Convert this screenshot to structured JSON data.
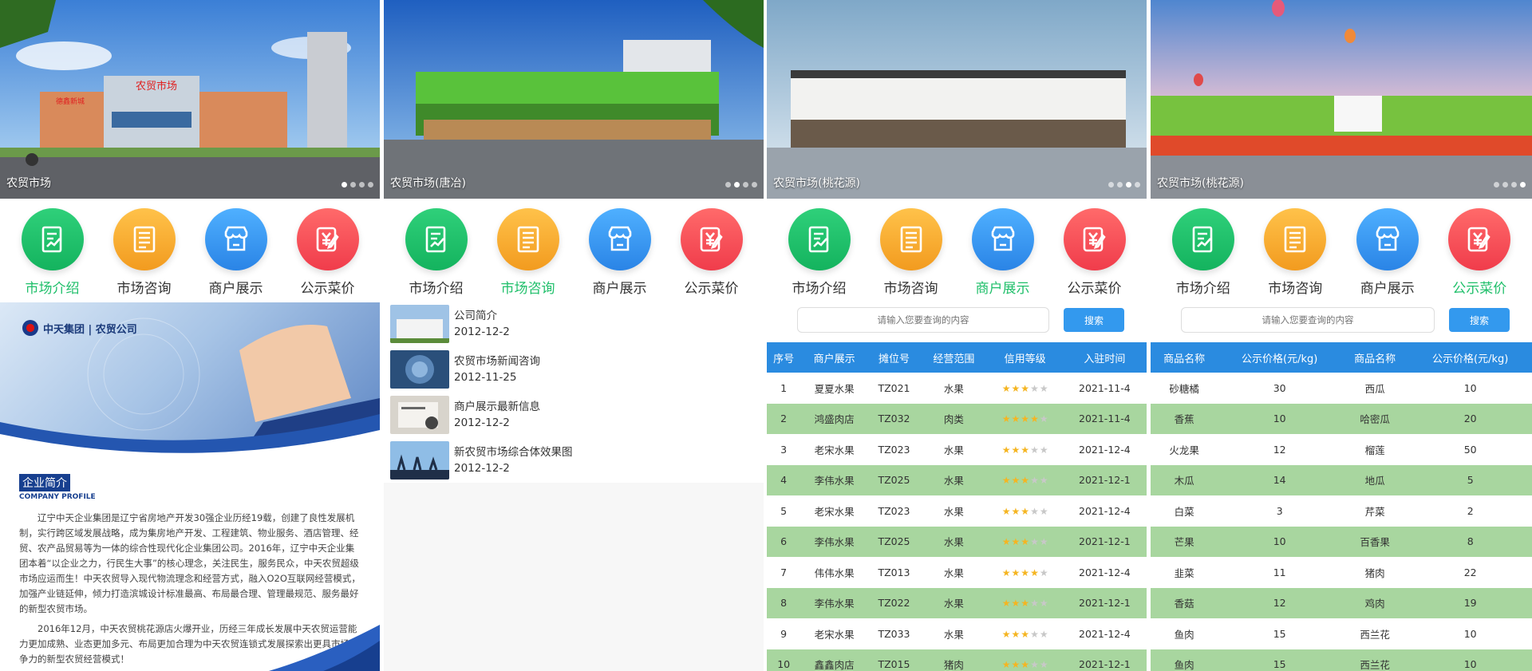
{
  "nav_items": [
    "市场介绍",
    "市场咨询",
    "商户展示",
    "公示菜价"
  ],
  "panels": [
    {
      "caption": "农贸市场",
      "active_nav": 0,
      "dots": 4,
      "active_dot": 0
    },
    {
      "caption": "农贸市场(唐冶)",
      "active_nav": 1,
      "dots": 4,
      "active_dot": 1
    },
    {
      "caption": "农贸市场(桃花源)",
      "active_nav": 2,
      "dots": 4,
      "active_dot": 2
    },
    {
      "caption": "农贸市场(桃花源)",
      "active_nav": 3,
      "dots": 4,
      "active_dot": 3
    }
  ],
  "banner_signs": {
    "p1_market": "农贸市场",
    "p1_side": "德鑫新城"
  },
  "company": {
    "logo_text": "中天集团 | 农贸公司",
    "title": "企业简介",
    "subtitle": "COMPANY PROFILE",
    "para1": "辽宁中天企业集团是辽宁省房地产开发30强企业历经19载，创建了良性发展机制，实行跨区域发展战略，成为集房地产开发、工程建筑、物业服务、酒店管理、经贸、农产品贸易等为一体的综合性现代化企业集团公司。2016年，辽宁中天企业集团本着“以企业之力，行民生大事”的核心理念，关注民生，服务民众，中天农贸超级市场应运而生！中天农贸导入现代物流理念和经营方式，融入O2O互联网经营模式，加强产业链延伸，倾力打造滨城设计标准最高、布局最合理、管理最规范、服务最好的新型农贸市场。",
    "para2": "2016年12月，中天农贸桃花源店火爆开业，历经三年成长发展中天农贸运营能力更加成熟、业态更加多元、布局更加合理为中天农贸连锁式发展探索出更具市场竞争力的新型农贸经营模式！"
  },
  "news": [
    {
      "title": "公司简介",
      "date": "2012-12-2"
    },
    {
      "title": "农贸市场新闻咨询",
      "date": "2012-11-25"
    },
    {
      "title": "商户展示最新信息",
      "date": "2012-12-2"
    },
    {
      "title": "新农贸市场综合体效果图",
      "date": "2012-12-2"
    }
  ],
  "search": {
    "placeholder": "请输入您要查询的内容",
    "button": "搜索"
  },
  "merchants": {
    "headers": [
      "序号",
      "商户展示",
      "摊位号",
      "经营范围",
      "信用等级",
      "入驻时间"
    ],
    "rows": [
      {
        "no": "1",
        "name": "夏夏水果",
        "stall": "TZ021",
        "scope": "水果",
        "rating": 3,
        "date": "2021-11-4"
      },
      {
        "no": "2",
        "name": "鸿盛肉店",
        "stall": "TZ032",
        "scope": "肉类",
        "rating": 4,
        "date": "2021-11-4"
      },
      {
        "no": "3",
        "name": "老宋水果",
        "stall": "TZ023",
        "scope": "水果",
        "rating": 3,
        "date": "2021-12-4"
      },
      {
        "no": "4",
        "name": "李伟水果",
        "stall": "TZ025",
        "scope": "水果",
        "rating": 3,
        "date": "2021-12-1"
      },
      {
        "no": "5",
        "name": "老宋水果",
        "stall": "TZ023",
        "scope": "水果",
        "rating": 3,
        "date": "2021-12-4"
      },
      {
        "no": "6",
        "name": "李伟水果",
        "stall": "TZ025",
        "scope": "水果",
        "rating": 3,
        "date": "2021-12-1"
      },
      {
        "no": "7",
        "name": "伟伟水果",
        "stall": "TZ013",
        "scope": "水果",
        "rating": 4,
        "date": "2021-12-4"
      },
      {
        "no": "8",
        "name": "李伟水果",
        "stall": "TZ022",
        "scope": "水果",
        "rating": 3,
        "date": "2021-12-1"
      },
      {
        "no": "9",
        "name": "老宋水果",
        "stall": "TZ033",
        "scope": "水果",
        "rating": 3,
        "date": "2021-12-4"
      },
      {
        "no": "10",
        "name": "鑫鑫肉店",
        "stall": "TZ015",
        "scope": "猪肉",
        "rating": 3,
        "date": "2021-12-1"
      }
    ]
  },
  "prices": {
    "headers": [
      "商品名称",
      "公示价格(元/kg)",
      "商品名称",
      "公示价格(元/kg)"
    ],
    "rows": [
      [
        "砂糖橘",
        "30",
        "西瓜",
        "10"
      ],
      [
        "香蕉",
        "10",
        "哈密瓜",
        "20"
      ],
      [
        "火龙果",
        "12",
        "榴莲",
        "50"
      ],
      [
        "木瓜",
        "14",
        "地瓜",
        "5"
      ],
      [
        "白菜",
        "3",
        "芹菜",
        "2"
      ],
      [
        "芒果",
        "10",
        "百香果",
        "8"
      ],
      [
        "韭菜",
        "11",
        "猪肉",
        "22"
      ],
      [
        "香菇",
        "12",
        "鸡肉",
        "19"
      ],
      [
        "鱼肉",
        "15",
        "西兰花",
        "10"
      ],
      [
        "鱼肉",
        "15",
        "西兰花",
        "10"
      ]
    ]
  },
  "colors": {
    "accent_green": "#1fbf6a",
    "table_header": "#2a8be0",
    "row_green": "#a8d69f"
  }
}
